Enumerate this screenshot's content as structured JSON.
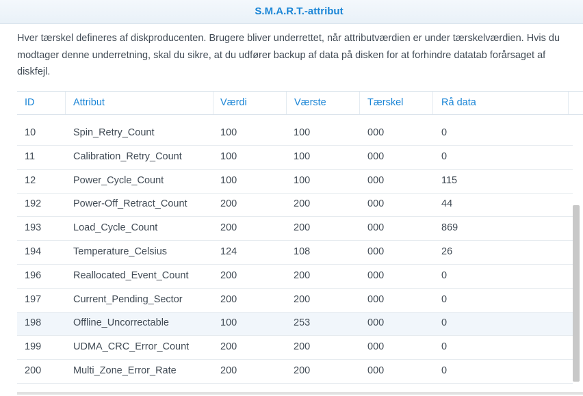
{
  "dialog": {
    "title": "S.M.A.R.T.-attribut",
    "description": "Hver tærskel defineres af diskproducenten. Brugere bliver underrettet, når attributværdien er under tærskelværdien. Hvis du modtager denne underretning, skal du sikre, at du udfører backup af data på disken for at forhindre datatab forårsaget af diskfejl."
  },
  "table": {
    "columns": [
      "ID",
      "Attribut",
      "Værdi",
      "Værste",
      "Tærskel",
      "Rå data"
    ],
    "rows": [
      [
        "10",
        "Spin_Retry_Count",
        "100",
        "100",
        "000",
        "0"
      ],
      [
        "11",
        "Calibration_Retry_Count",
        "100",
        "100",
        "000",
        "0"
      ],
      [
        "12",
        "Power_Cycle_Count",
        "100",
        "100",
        "000",
        "115"
      ],
      [
        "192",
        "Power-Off_Retract_Count",
        "200",
        "200",
        "000",
        "44"
      ],
      [
        "193",
        "Load_Cycle_Count",
        "200",
        "200",
        "000",
        "869"
      ],
      [
        "194",
        "Temperature_Celsius",
        "124",
        "108",
        "000",
        "26"
      ],
      [
        "196",
        "Reallocated_Event_Count",
        "200",
        "200",
        "000",
        "0"
      ],
      [
        "197",
        "Current_Pending_Sector",
        "200",
        "200",
        "000",
        "0"
      ],
      [
        "198",
        "Offline_Uncorrectable",
        "100",
        "253",
        "000",
        "0"
      ],
      [
        "199",
        "UDMA_CRC_Error_Count",
        "200",
        "200",
        "000",
        "0"
      ],
      [
        "200",
        "Multi_Zone_Error_Rate",
        "200",
        "200",
        "000",
        "0"
      ]
    ],
    "selected_row_index": 8
  },
  "colors": {
    "accent": "#1a85d6",
    "text": "#414b55",
    "selected_row": "#f1f6fb",
    "scrollbar_thumb": "#c8c8c8"
  }
}
